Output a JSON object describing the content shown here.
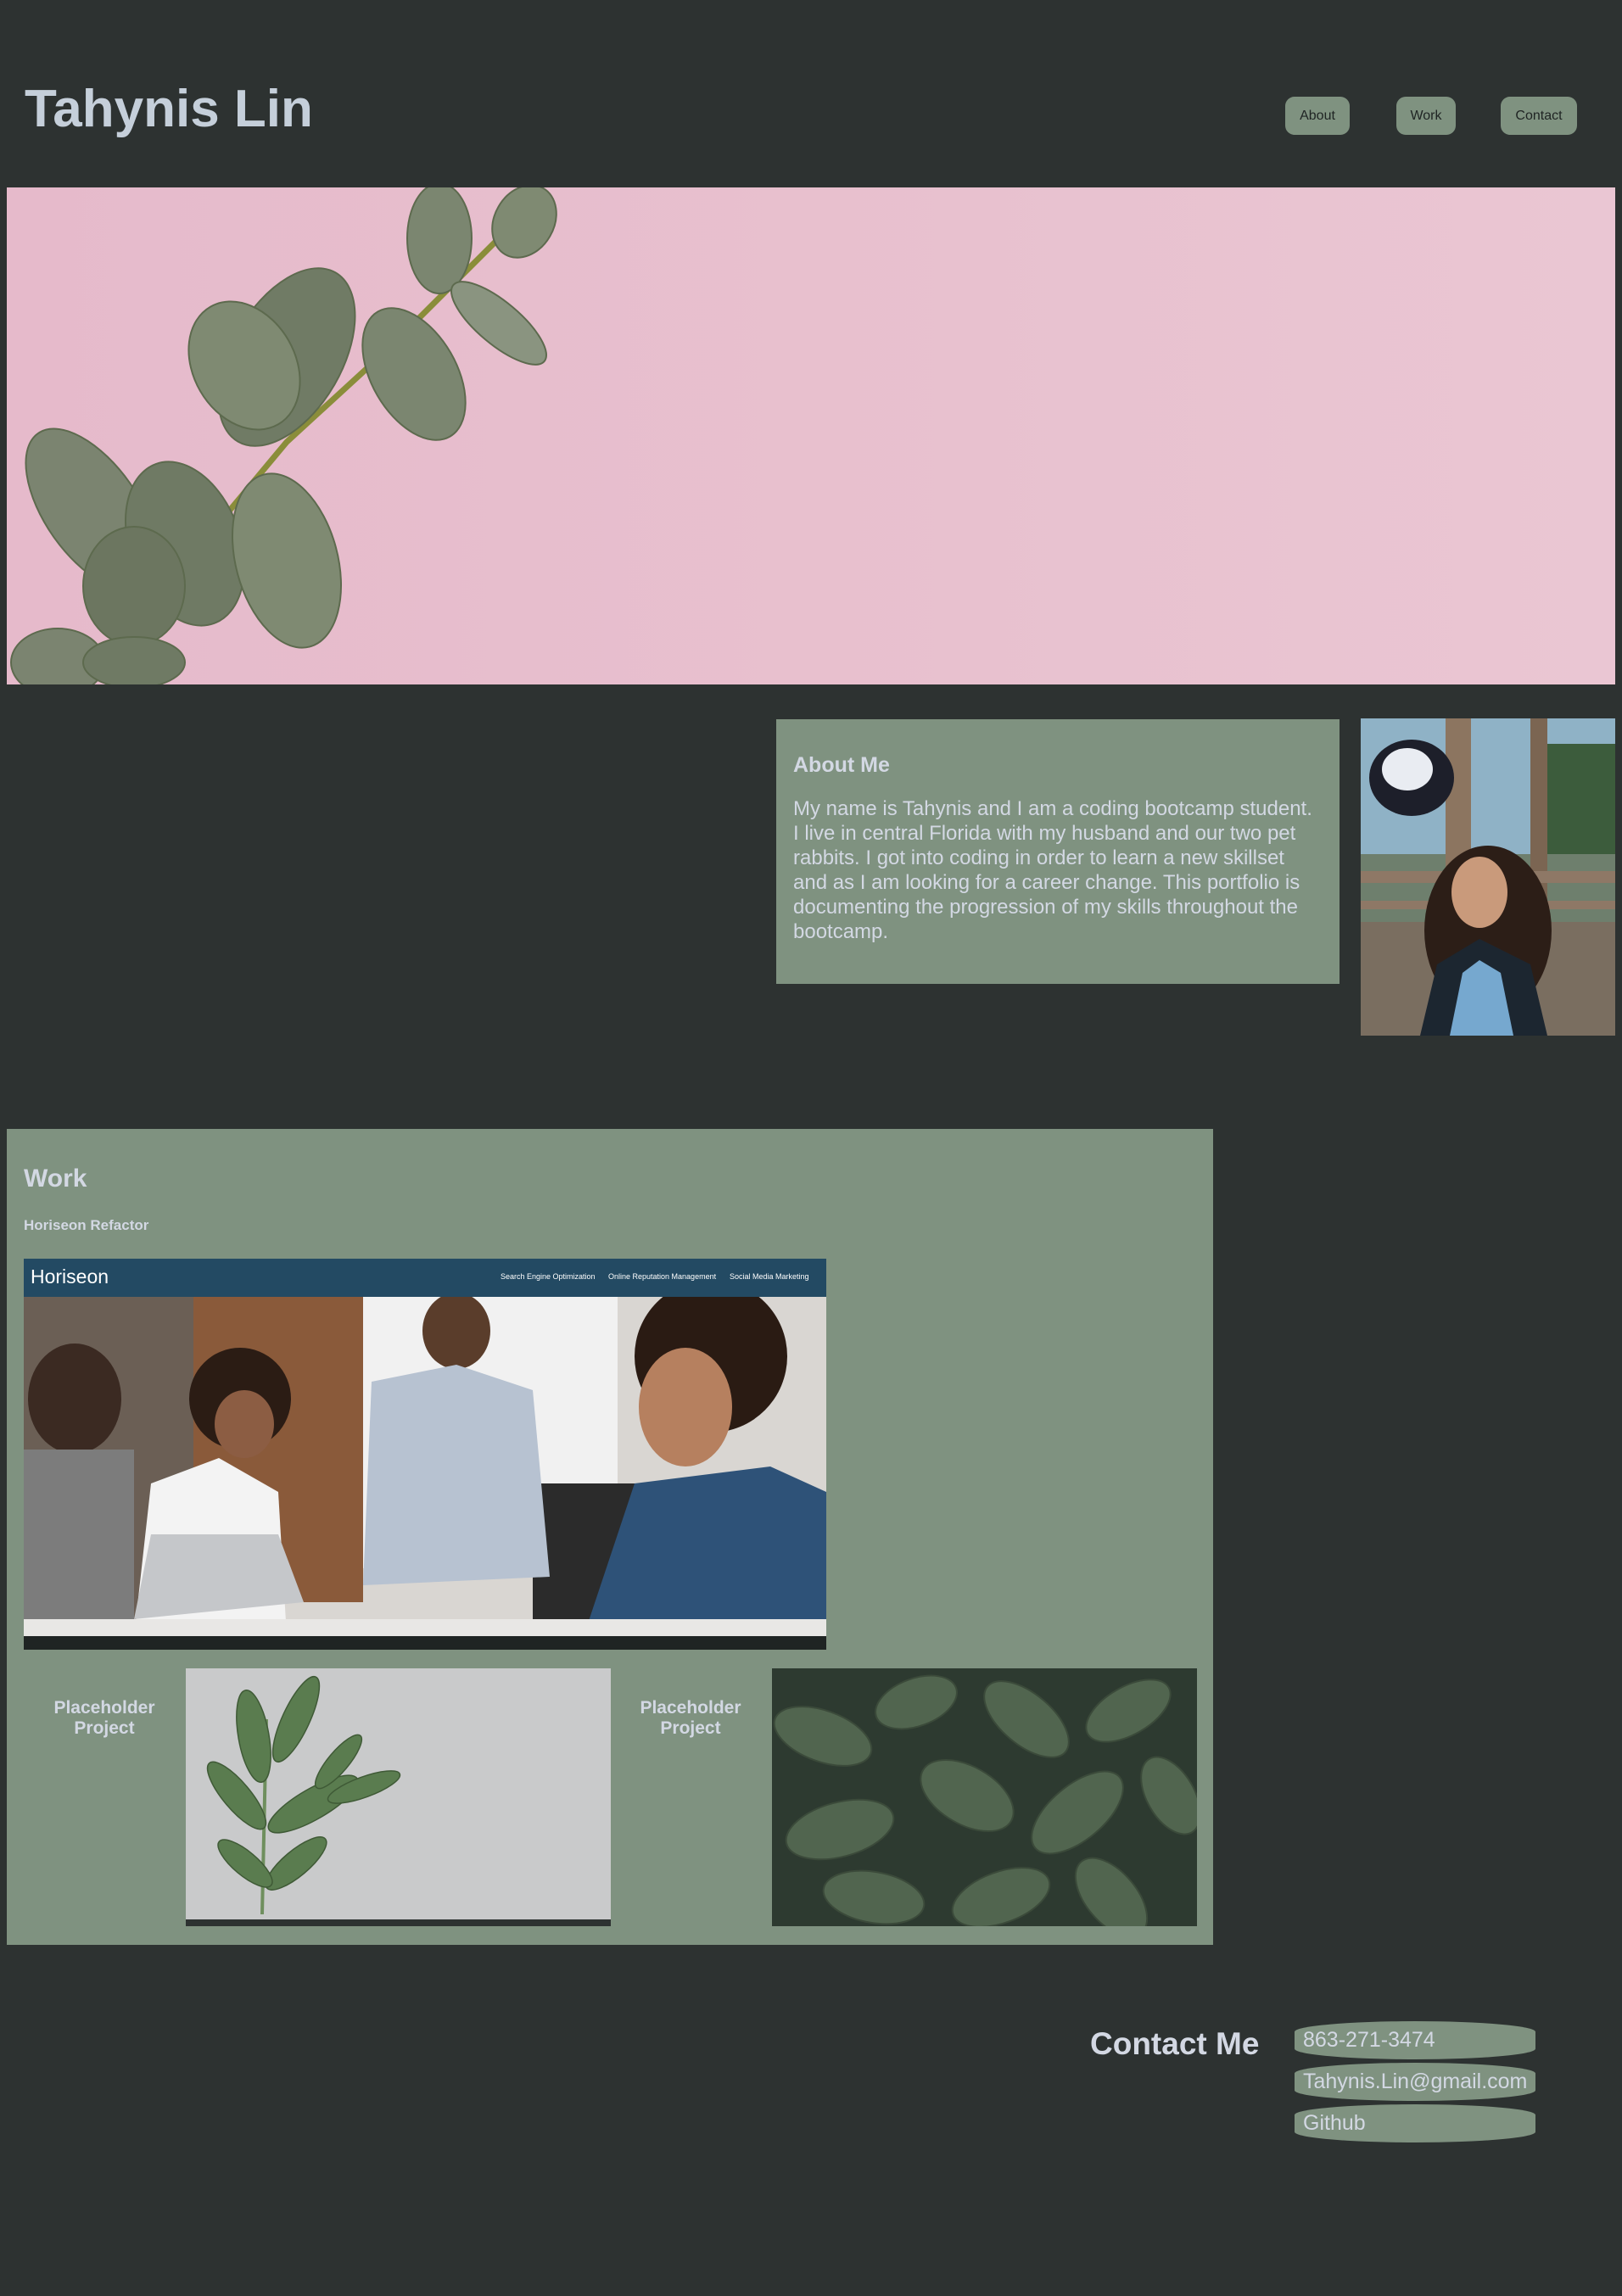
{
  "header": {
    "title": "Tahynis Lin",
    "nav": [
      {
        "label": "About"
      },
      {
        "label": "Work"
      },
      {
        "label": "Contact"
      }
    ]
  },
  "about": {
    "title": "About Me",
    "text": "My name is Tahynis and I am a coding bootcamp student. I live in central Florida with my husband and our two pet rabbits. I got into coding in order to learn a new skillset and as I am looking for a career change. This portfolio is documenting the progression of my skills throughout the bootcamp."
  },
  "work": {
    "title": "Work",
    "featured": {
      "label": "Horiseon Refactor",
      "screenshot": {
        "brand": "Horiseon",
        "nav": [
          "Search Engine Optimization",
          "Online Reputation Management",
          "Social Media Marketing"
        ]
      }
    },
    "projects": [
      {
        "label": "Placeholder Project"
      },
      {
        "label": "Placeholder Project"
      }
    ]
  },
  "contact": {
    "title": "Contact Me",
    "items": [
      {
        "label": "863-271-3474"
      },
      {
        "label": "Tahynis.Lin@gmail.com"
      },
      {
        "label": "Github"
      }
    ]
  },
  "colors": {
    "background": "#2d3231",
    "accent": "#7f9280",
    "text": "#d3d8e3",
    "hero": "#e8bfd0"
  }
}
